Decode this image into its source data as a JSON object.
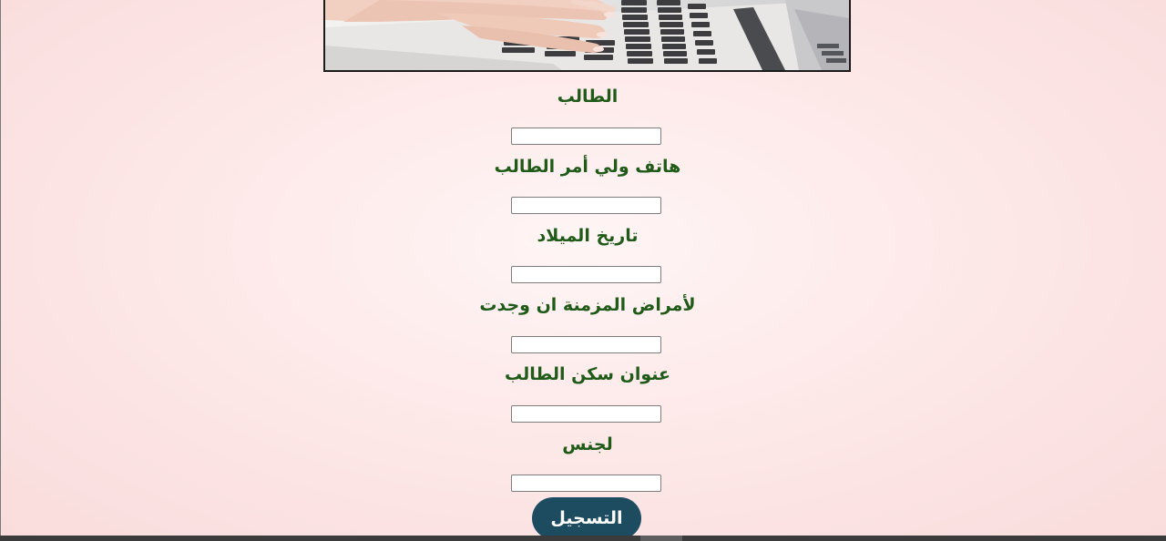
{
  "hero": {
    "icon": "typing-on-laptop-photo"
  },
  "form": {
    "fields": [
      {
        "label": "الطالب",
        "value": "",
        "placeholder": ""
      },
      {
        "label": "هاتف ولي أمر الطالب",
        "value": "",
        "placeholder": ""
      },
      {
        "label": "تاريخ الميلاد",
        "value": "",
        "placeholder": ""
      },
      {
        "label": "لأمراض المزمنة ان وجدت",
        "value": "",
        "placeholder": ""
      },
      {
        "label": "عنوان سكن الطالب",
        "value": "",
        "placeholder": ""
      },
      {
        "label": "لجنس",
        "value": "",
        "placeholder": ""
      }
    ],
    "submit_label": "التسجيل"
  },
  "colors": {
    "label_green": "#1f5a18",
    "button_bg": "#1d4c60",
    "page_bg": "#fde6e6"
  }
}
